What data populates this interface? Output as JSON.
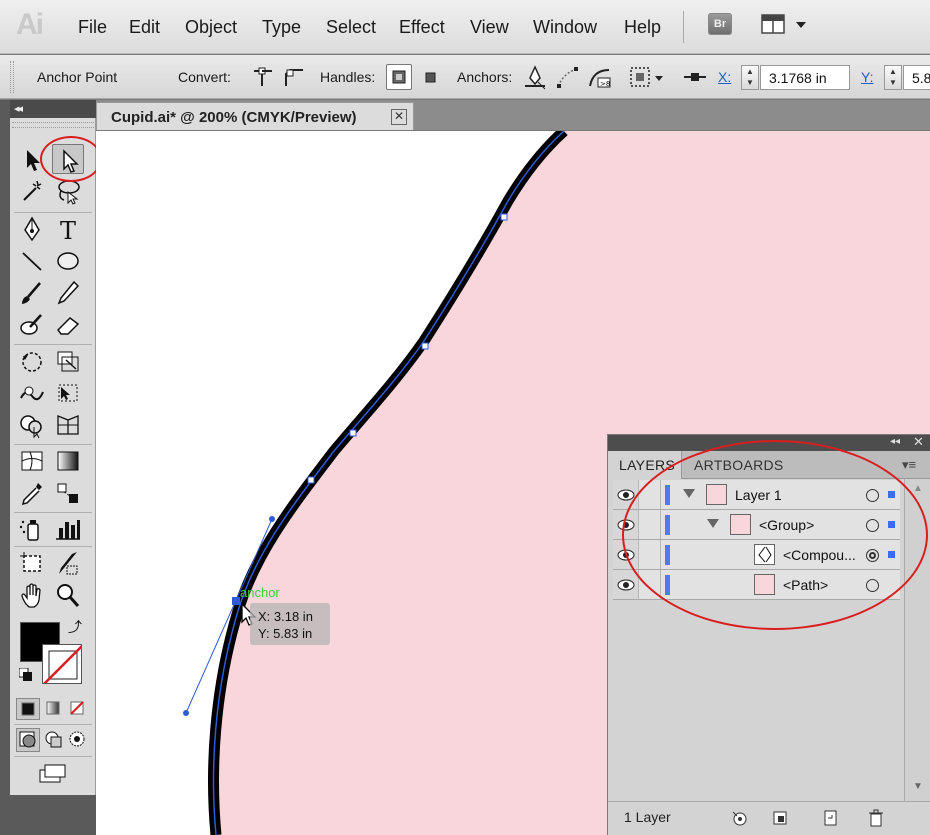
{
  "app": {
    "logo": "Ai",
    "bridge_label": "Br"
  },
  "menu": {
    "items": [
      "File",
      "Edit",
      "Object",
      "Type",
      "Select",
      "Effect",
      "View",
      "Window",
      "Help"
    ]
  },
  "control_bar": {
    "context_label": "Anchor Point",
    "convert_label": "Convert:",
    "handles_label": "Handles:",
    "anchors_label": "Anchors:",
    "x_label": "X:",
    "x_value": "3.1768 in",
    "y_label": "Y:",
    "y_value": "5.8"
  },
  "document": {
    "tab_title": "Cupid.ai* @ 200% (CMYK/Preview)",
    "close_glyph": "✕"
  },
  "tools": {
    "header_glyph": "◂◂",
    "selected": "direct-selection-tool"
  },
  "cursor_tooltip": {
    "hint": "anchor",
    "x_line": "X: 3.18 in",
    "y_line": "Y: 5.83 in"
  },
  "colors": {
    "artwork_fill": "#f9d6dc",
    "path_stroke": "#000000",
    "selection_blue": "#2f5bd6",
    "highlight_red": "#d81e1e",
    "smart_guide_green": "#3bd23b"
  },
  "layers_panel": {
    "tabs": [
      "LAYERS",
      "ARTBOARDS"
    ],
    "active_tab": "LAYERS",
    "collapse_glyph": "◂◂",
    "close_glyph": "✕",
    "menu_glyph": "▾≡",
    "rows": [
      {
        "name": "Layer 1",
        "depth": 0,
        "expanded": true,
        "thumb": "pink"
      },
      {
        "name": "<Group>",
        "depth": 1,
        "expanded": true,
        "thumb": "pink"
      },
      {
        "name": "<Compou...",
        "depth": 2,
        "expanded": false,
        "thumb": "outline"
      },
      {
        "name": "<Path>",
        "depth": 2,
        "expanded": false,
        "thumb": "pink"
      }
    ],
    "footer": {
      "layer_count": "1 Layer"
    }
  }
}
